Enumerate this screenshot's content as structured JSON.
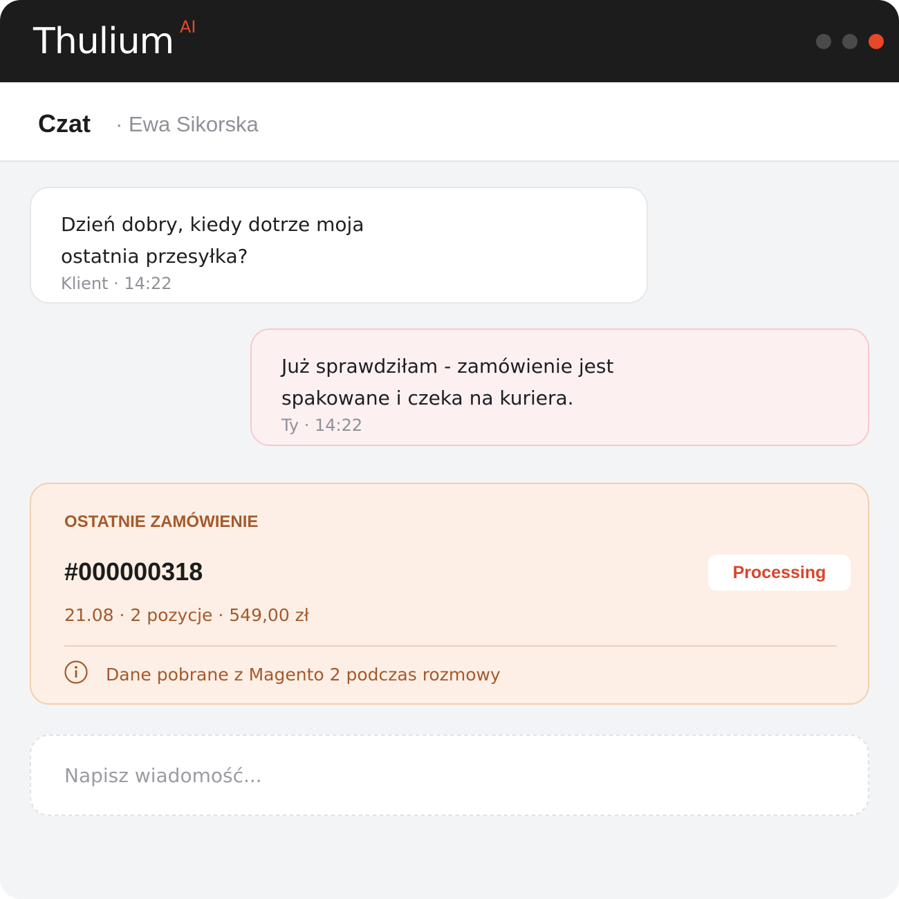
{
  "app": {
    "brand_name": "Thulium",
    "brand_badge": "AI"
  },
  "chat": {
    "title": "Czat",
    "contact": "· Ewa Sikorska"
  },
  "messages": [
    {
      "text": "Dzień dobry, kiedy dotrze moja ostatnia przesyłka?",
      "meta": "Klient · 14:22"
    },
    {
      "text": "Już sprawdziłam - zamówienie jest spakowane i czeka na kuriera.",
      "meta": "Ty · 14:22"
    }
  ],
  "order": {
    "label": "OSTATNIE ZAMÓWIENIE",
    "number": "#000000318",
    "status": "Processing",
    "details": "21.08 · 2 pozycje · 549,00 zł",
    "note": "Dane pobrane z Magento 2 podczas rozmowy",
    "icon": "info-icon"
  },
  "composer": {
    "placeholder": "Napisz wiadomość..."
  },
  "colors": {
    "accent": "#e8472a",
    "titlebar": "#1c1c1c",
    "order_text": "#a45a2c",
    "status_text": "#d9452a"
  }
}
